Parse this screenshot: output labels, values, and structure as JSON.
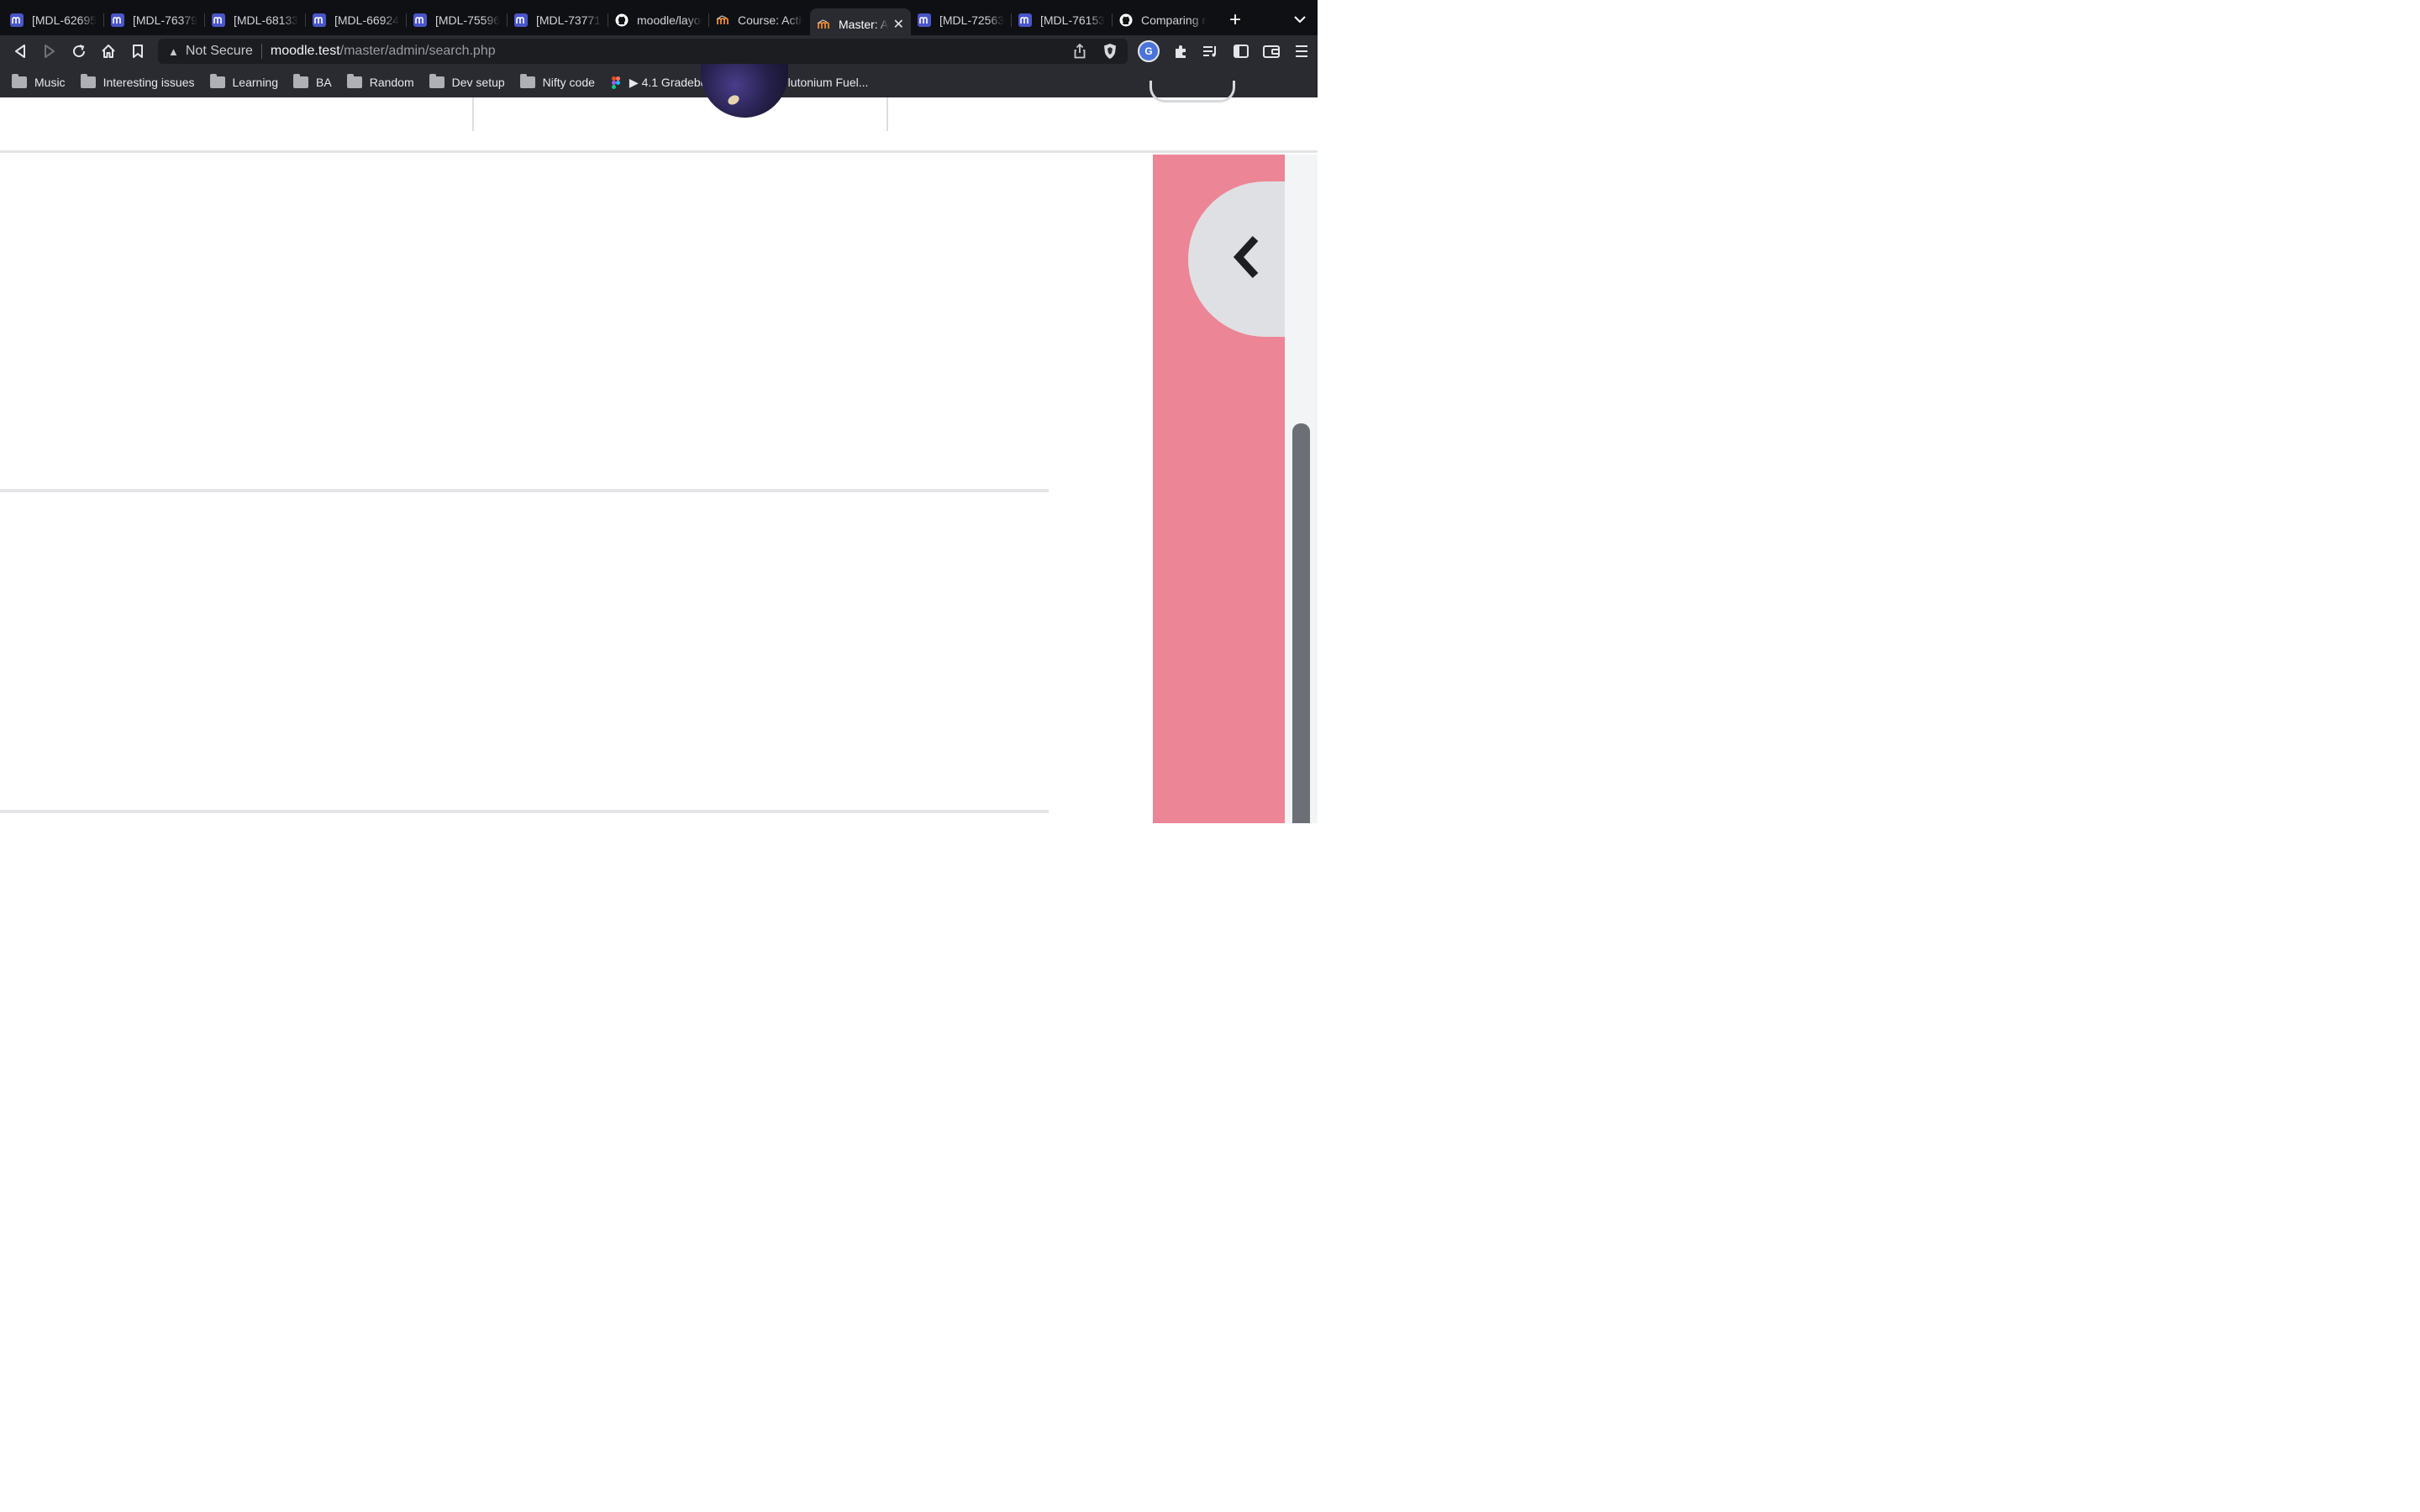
{
  "browser": {
    "tabs": [
      {
        "label": "[MDL-62695",
        "favicon": "moodle-tracker-icon",
        "active": false
      },
      {
        "label": "[MDL-76379",
        "favicon": "moodle-tracker-icon",
        "active": false
      },
      {
        "label": "[MDL-68133",
        "favicon": "moodle-tracker-icon",
        "active": false
      },
      {
        "label": "[MDL-66924",
        "favicon": "moodle-tracker-icon",
        "active": false
      },
      {
        "label": "[MDL-75596",
        "favicon": "moodle-tracker-icon",
        "active": false
      },
      {
        "label": "[MDL-73771]",
        "favicon": "moodle-tracker-icon",
        "active": false
      },
      {
        "label": "moodle/layou",
        "favicon": "github-icon",
        "active": false
      },
      {
        "label": "Course: Activ",
        "favicon": "moodle-site-icon",
        "active": false
      },
      {
        "label": "Master: A",
        "favicon": "moodle-site-icon",
        "active": true
      },
      {
        "label": "[MDL-72563",
        "favicon": "moodle-tracker-icon",
        "active": false
      },
      {
        "label": "[MDL-76153",
        "favicon": "moodle-tracker-icon",
        "active": false
      },
      {
        "label": "Comparing m",
        "favicon": "github-icon",
        "active": false
      }
    ],
    "new_tab_label": "+",
    "address": {
      "security_label": "Not Secure",
      "host": "moodle.test",
      "path": "/master/admin/search.php"
    },
    "bookmarks": [
      {
        "label": "Music",
        "icon": "folder-icon"
      },
      {
        "label": "Interesting issues",
        "icon": "folder-icon"
      },
      {
        "label": "Learning",
        "icon": "folder-icon"
      },
      {
        "label": "BA",
        "icon": "folder-icon"
      },
      {
        "label": "Random",
        "icon": "folder-icon"
      },
      {
        "label": "Dev setup",
        "icon": "folder-icon"
      },
      {
        "label": "Nifty code",
        "icon": "folder-icon"
      },
      {
        "label": "▶ 4.1 Gradebook...",
        "icon": "figma-icon"
      },
      {
        "label": "10 Plutonium Fuel...",
        "icon": "s-logo-icon"
      }
    ],
    "profile_initial": "G"
  },
  "page": {
    "drawer_color": "#ec8595",
    "drawer_toggle_icon": "chevron-left-icon"
  }
}
